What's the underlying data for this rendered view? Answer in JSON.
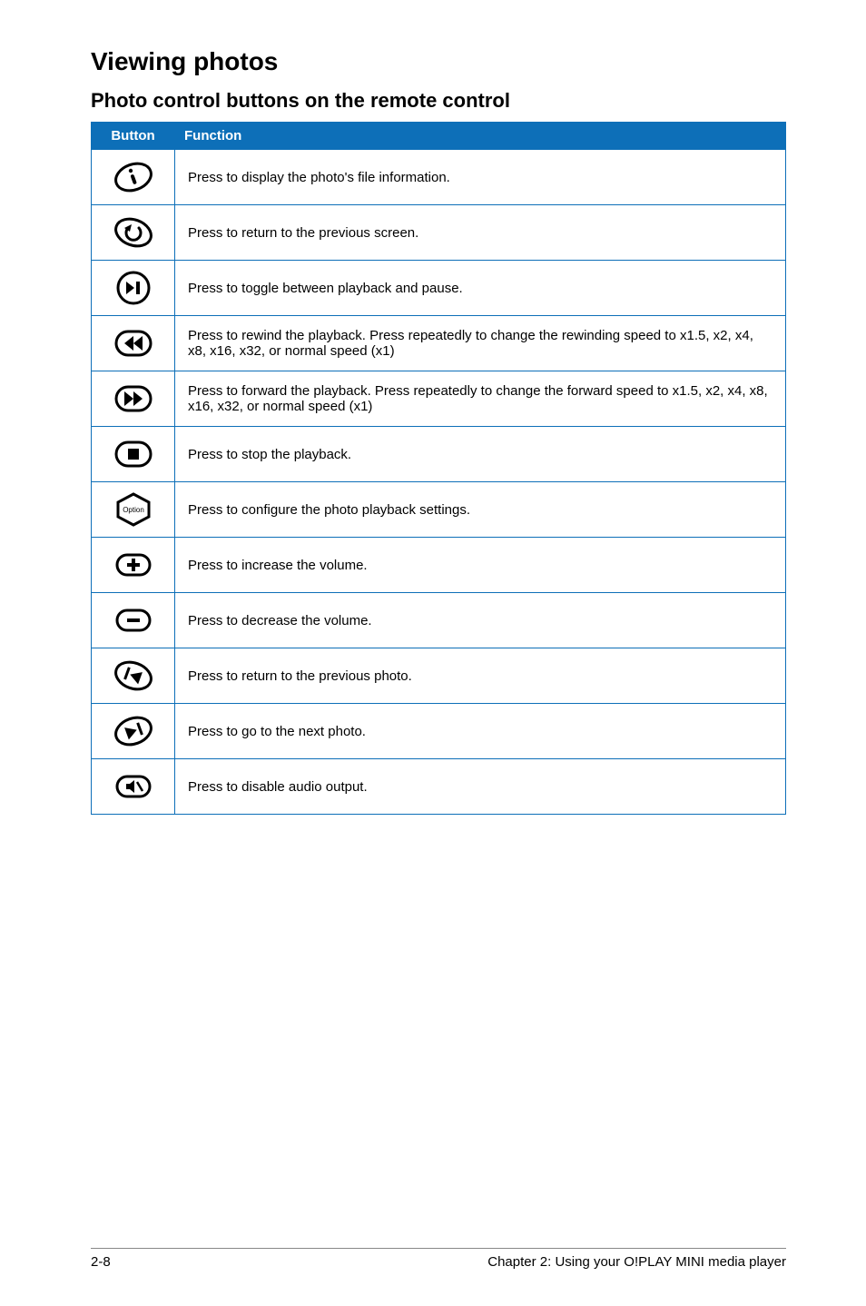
{
  "section": {
    "title": "Viewing photos",
    "subtitle": "Photo control buttons on the remote control"
  },
  "table": {
    "headers": {
      "button": "Button",
      "function": "Function"
    },
    "rows": [
      {
        "icon": "info-icon",
        "func": "Press to display the photo's file information."
      },
      {
        "icon": "return-icon",
        "func": "Press to return to the previous screen."
      },
      {
        "icon": "play-pause-icon",
        "func": "Press to toggle between playback and pause."
      },
      {
        "icon": "rewind-icon",
        "func": "Press to rewind the playback. Press repeatedly to change the rewinding speed to x1.5, x2, x4, x8, x16, x32, or normal speed (x1)"
      },
      {
        "icon": "forward-icon",
        "func": "Press to forward the playback. Press repeatedly to change the forward speed to x1.5, x2, x4, x8, x16, x32, or normal speed (x1)"
      },
      {
        "icon": "stop-icon",
        "func": "Press to stop the playback."
      },
      {
        "icon": "option-icon",
        "func": "Press to configure the photo playback settings."
      },
      {
        "icon": "volume-up-icon",
        "func": "Press to increase the volume."
      },
      {
        "icon": "volume-down-icon",
        "func": "Press to decrease the volume."
      },
      {
        "icon": "prev-photo-icon",
        "func": "Press to return to the previous photo."
      },
      {
        "icon": "next-photo-icon",
        "func": "Press to go to the next photo."
      },
      {
        "icon": "mute-icon",
        "func": "Press to disable audio output."
      }
    ]
  },
  "footer": {
    "page": "2-8",
    "chapter": "Chapter 2: Using your O!PLAY MINI media player"
  }
}
